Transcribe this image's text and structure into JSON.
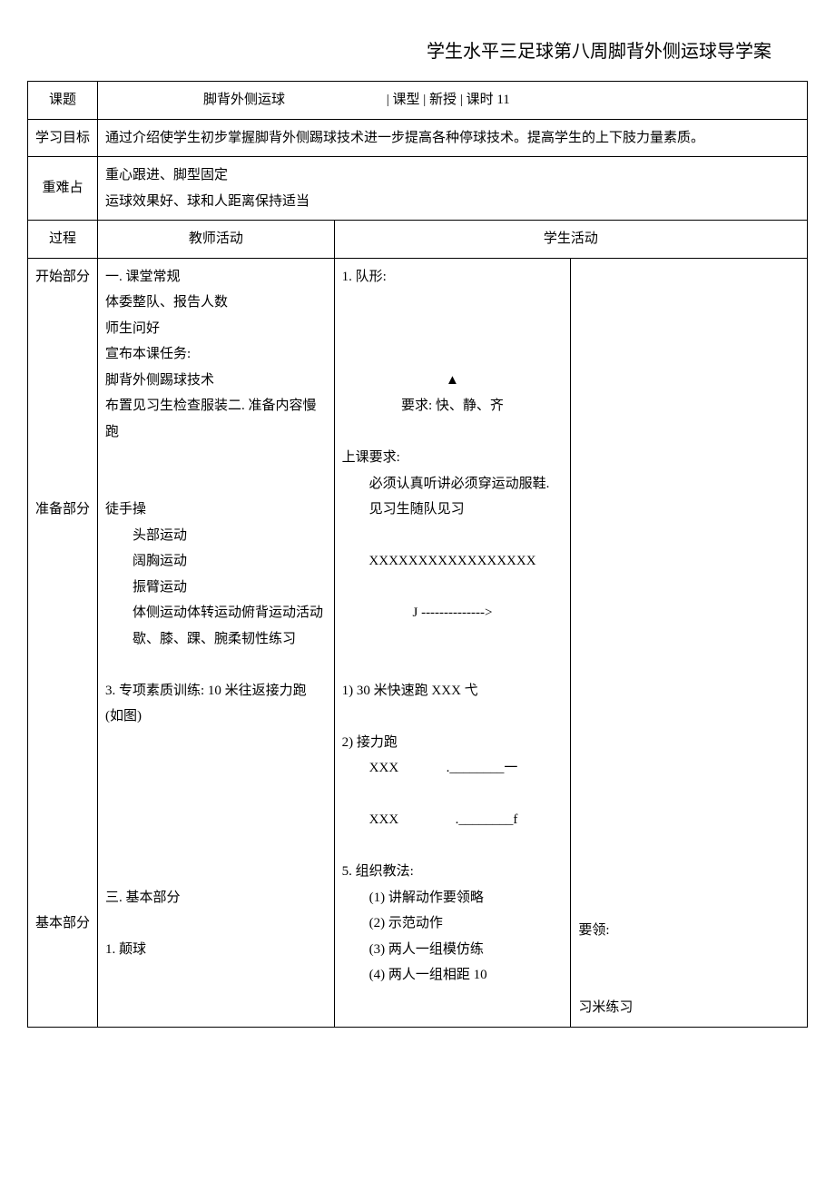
{
  "title": "学生水平三足球第八周脚背外侧运球导学案",
  "labels": {
    "topic": "课题",
    "classType": "课型",
    "period": "课时",
    "goals": "学习目标",
    "difficulty": "重难占",
    "process": "过程",
    "teacher": "教师活动",
    "student": "学生活动"
  },
  "topic": {
    "name": "脚背外侧运球",
    "classType": "新授",
    "period": "11"
  },
  "goals": "通过介绍使学生初步掌握脚背外侧踢球技术进一步提高各种停球技术。提高学生的上下肢力量素质。",
  "difficulty": {
    "line1": "重心跟进、脚型固定",
    "line2": "运球效果好、球和人距离保持适当"
  },
  "sections": {
    "start": "开始部分",
    "prep": "准备部分",
    "main": "基本部分"
  },
  "teacher": {
    "s1": "一. 课堂常规",
    "s2": "体委整队、报告人数",
    "s3": "师生问好",
    "s4": "宣布本课任务:",
    "s5": "脚背外侧踢球技术",
    "s6": "布置见习生检查服装二. 准备内容慢跑",
    "s7": "徒手操",
    "s8": "头部运动",
    "s9": "阔胸运动",
    "s10": "振臂运动",
    "s11": "体侧运动体转运动俯背运动活动歇、膝、踝、腕柔韧性练习",
    "s12": "3. 专项素质训练: 10 米往返接力跑 (如图)",
    "s13": "三. 基本部分",
    "s14": "1. 颠球"
  },
  "student": {
    "s1": "1. 队形:",
    "symbol": "▲",
    "s2": "要求: 快、静、齐",
    "s3": "上课要求:",
    "s4": "必须认真听讲必须穿运动服鞋. 见习生随队见习",
    "s5": "XXXXXXXXXXXXXXXXX",
    "s6": "J -------------->",
    "s7": "1) 30 米快速跑 XXX 弋",
    "s8": "2) 接力跑",
    "relay1a": "XXX",
    "relay1b": ".________一",
    "relay2a": "XXX",
    "relay2b": ".________f",
    "s9": "5. 组织教法:",
    "m1": "(1) 讲解动作要领略",
    "m2": "(2) 示范动作",
    "m3": "(3) 两人一组模仿练",
    "m4": "(4) 两人一组相距 10"
  },
  "extra": {
    "r1": "要领:",
    "r2": "习米练习"
  }
}
